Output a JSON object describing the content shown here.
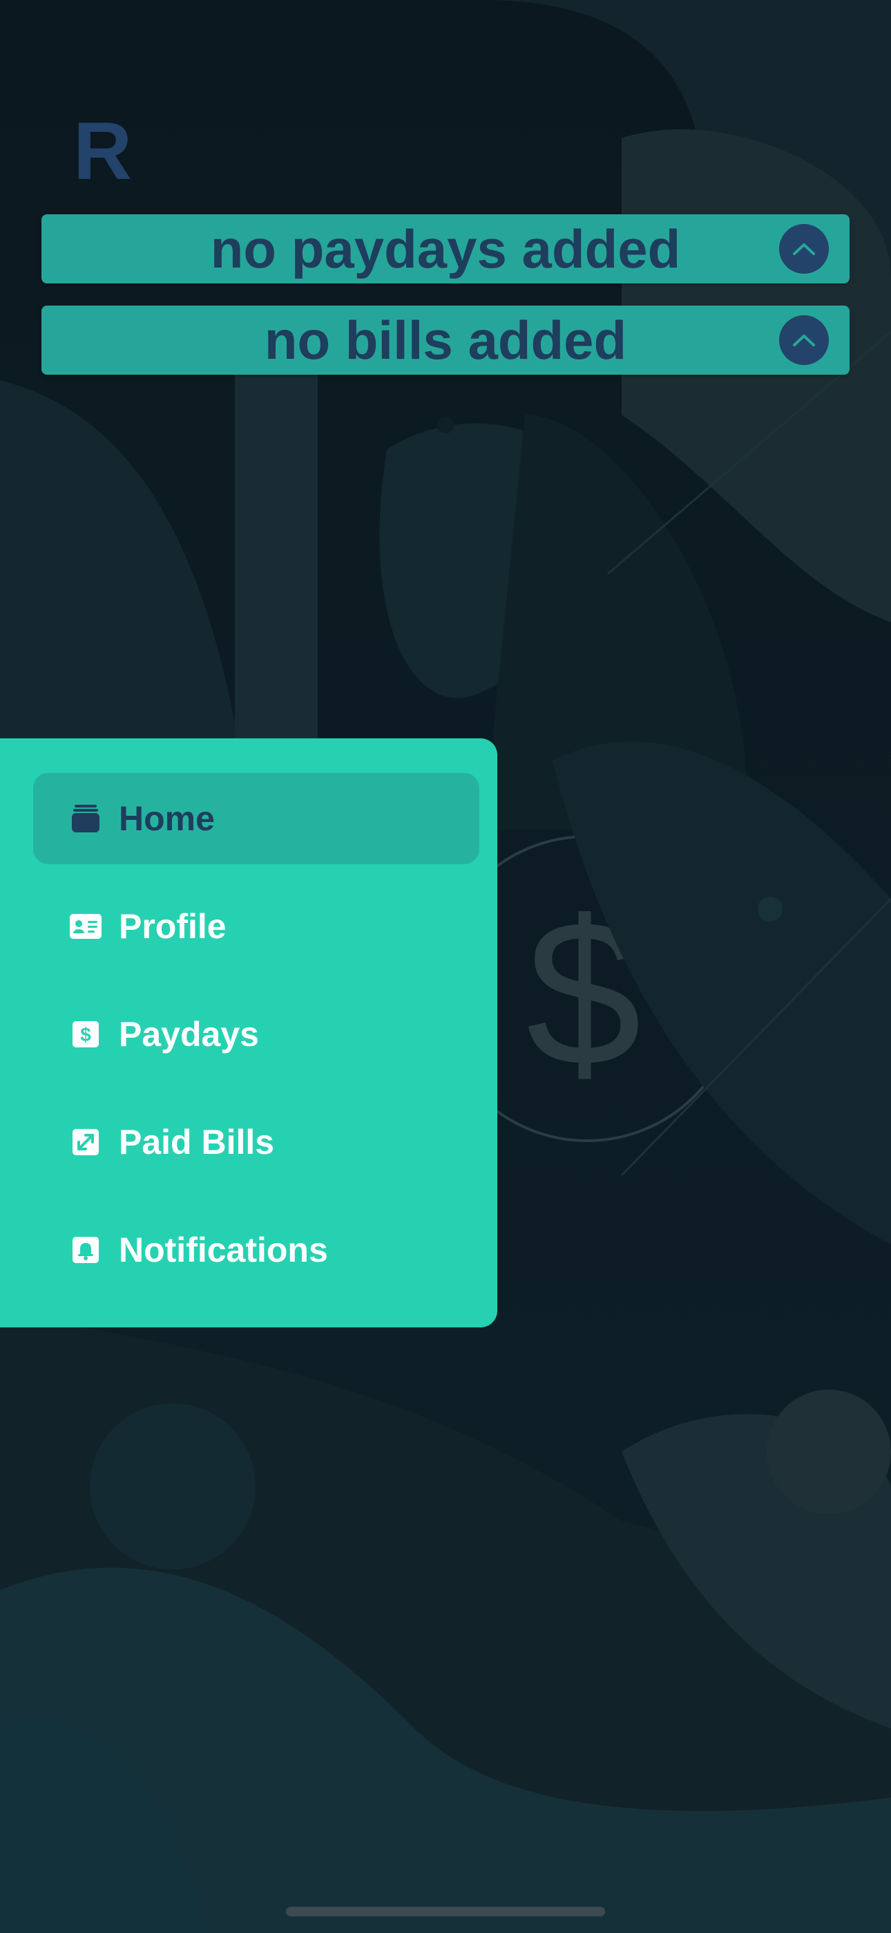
{
  "profile": {
    "initial": "R"
  },
  "banners": [
    {
      "text": "no paydays added",
      "button_icon": "chevron-up-icon"
    },
    {
      "text": "no bills added",
      "button_icon": "chevron-up-icon"
    }
  ],
  "drawer": {
    "items": [
      {
        "label": "Home",
        "icon": "stack-icon",
        "active": true
      },
      {
        "label": "Profile",
        "icon": "id-card-icon",
        "active": false
      },
      {
        "label": "Paydays",
        "icon": "dollar-icon",
        "active": false
      },
      {
        "label": "Paid Bills",
        "icon": "receipt-icon",
        "active": false
      },
      {
        "label": "Notifications",
        "icon": "bell-icon",
        "active": false
      }
    ]
  },
  "colors": {
    "background": "#0c1a22",
    "banner": "#26a69a",
    "banner_text": "#1f3d5c",
    "drawer": "#26d1b1",
    "drawer_active": "#25b3a0",
    "accent": "#23436a"
  }
}
